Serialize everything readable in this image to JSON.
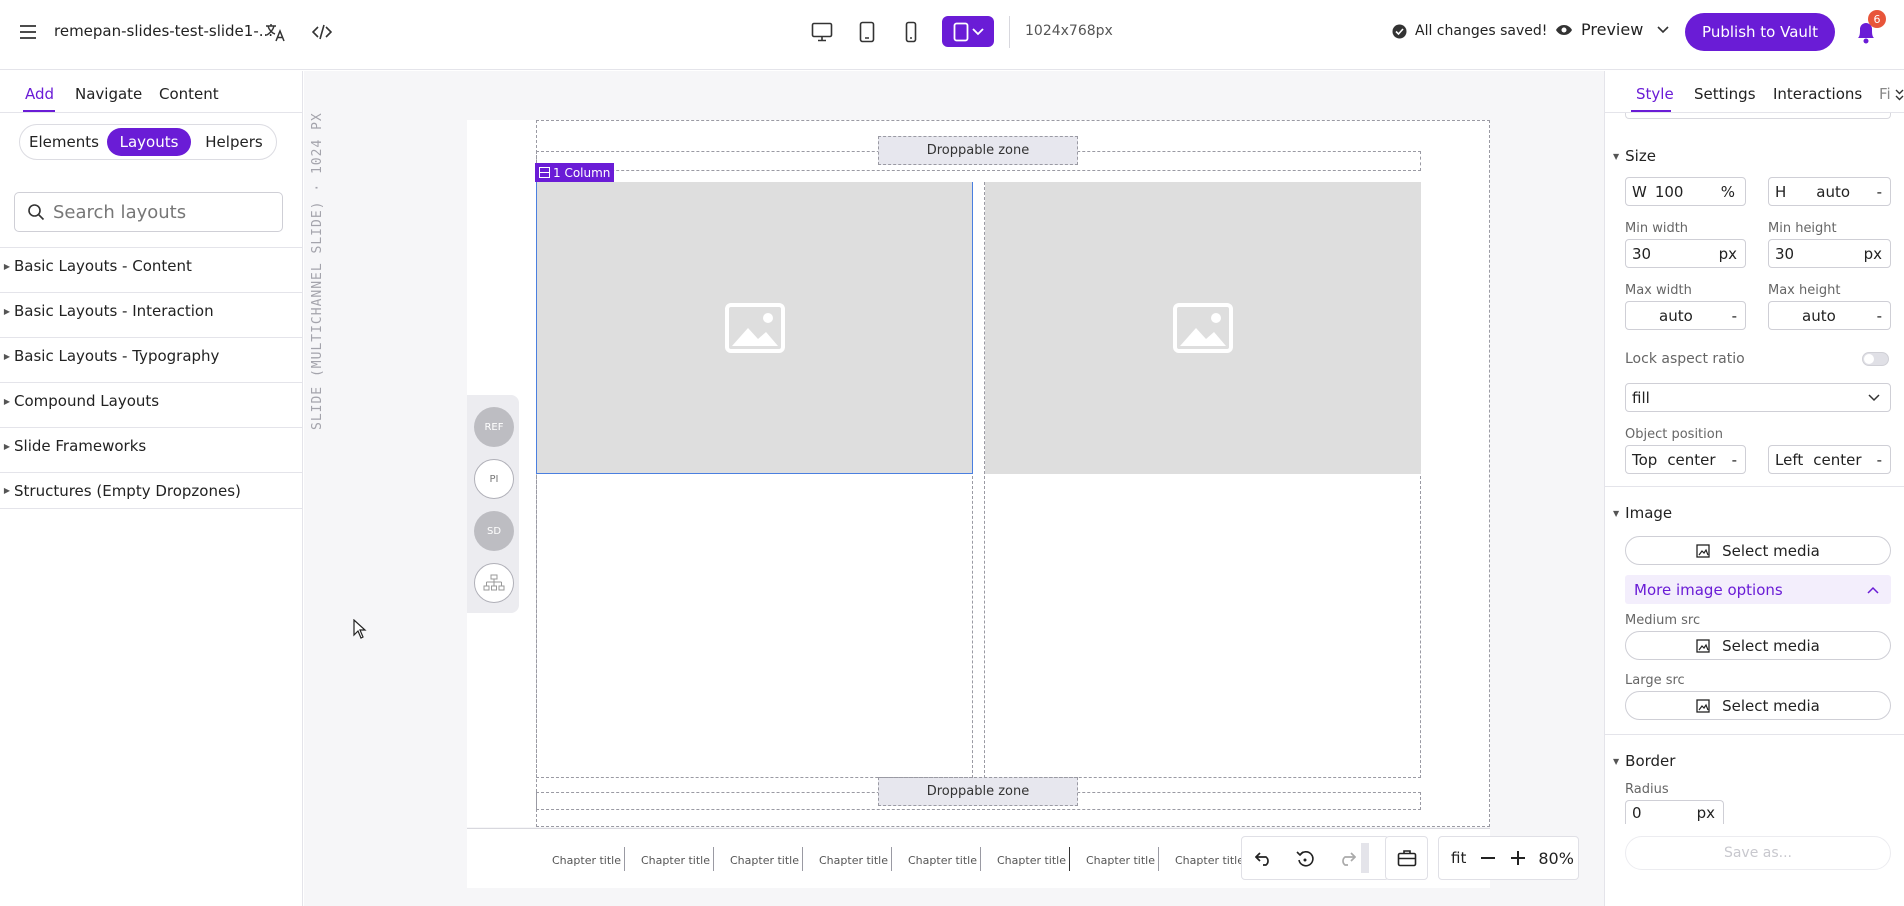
{
  "topbar": {
    "file_name": "remepan-slides-test-slide1-...",
    "resolution": "1024x768px",
    "saved_status": "All changes saved!",
    "preview_label": "Preview",
    "publish_label": "Publish to Vault",
    "notification_count": "6",
    "accent": "#6a1cd6"
  },
  "left_panel": {
    "tabs": [
      "Add",
      "Navigate",
      "Content"
    ],
    "active_tab": "Add",
    "segments": [
      "Elements",
      "Layouts",
      "Helpers"
    ],
    "active_segment": "Layouts",
    "search_placeholder": "Search layouts",
    "categories": [
      "Basic Layouts - Content",
      "Basic Layouts - Interaction",
      "Basic Layouts - Typography",
      "Compound Layouts",
      "Slide Frameworks",
      "Structures (Empty Dropzones)"
    ]
  },
  "canvas": {
    "vertical_label": "SLIDE (MULTICHANNEL SLIDE) · 1024 PX",
    "column_tag": "1 Column",
    "dropzone_label": "Droppable zone",
    "side_buttons": [
      "REF",
      "PI",
      "SD"
    ],
    "chapter_titles": [
      "Chapter title",
      "Chapter title",
      "Chapter title",
      "Chapter title",
      "Chapter title",
      "Chapter title",
      "Chapter title",
      "Chapter title"
    ],
    "zoom": {
      "fit_label": "fit",
      "value": "80%"
    }
  },
  "right_panel": {
    "tabs": [
      "Style",
      "Settings",
      "Interactions",
      "Fi"
    ],
    "active_tab": "Style",
    "size": {
      "title": "Size",
      "width_prefix": "W",
      "width_value": "100",
      "width_unit": "%",
      "height_prefix": "H",
      "height_value": "auto",
      "height_unit": "-",
      "min_width_label": "Min width",
      "min_width_value": "30",
      "min_width_unit": "px",
      "min_height_label": "Min height",
      "min_height_value": "30",
      "min_height_unit": "px",
      "max_width_label": "Max width",
      "max_width_value": "auto",
      "max_width_unit": "-",
      "max_height_label": "Max height",
      "max_height_value": "auto",
      "max_height_unit": "-",
      "lock_aspect_label": "Lock aspect ratio",
      "fit_value": "fill",
      "object_position_label": "Object position",
      "pos_top_prefix": "Top",
      "pos_top_value": "center",
      "pos_top_unit": "-",
      "pos_left_prefix": "Left",
      "pos_left_value": "center",
      "pos_left_unit": "-"
    },
    "image": {
      "title": "Image",
      "select_media": "Select media",
      "more_options": "More image options",
      "medium_src_label": "Medium src",
      "large_src_label": "Large src"
    },
    "border": {
      "title": "Border",
      "radius_label": "Radius",
      "radius_value": "0",
      "radius_unit": "px"
    },
    "save_as": "Save as..."
  }
}
